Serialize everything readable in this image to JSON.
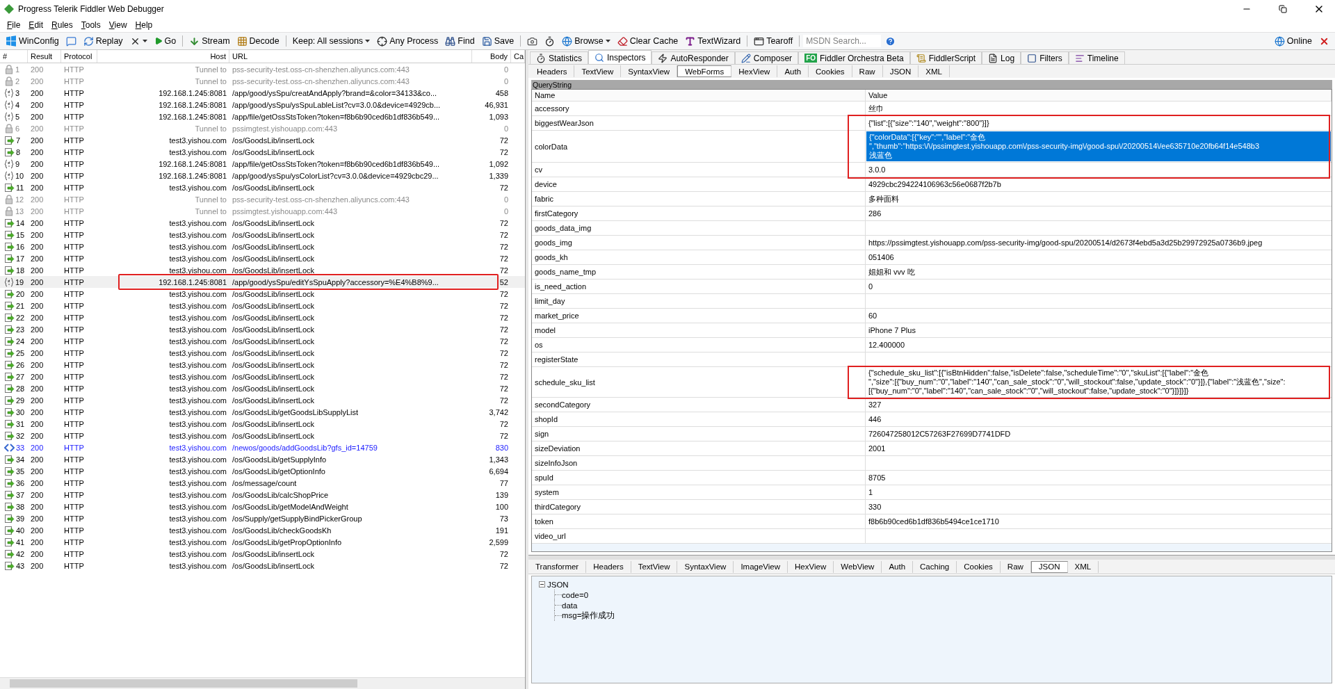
{
  "window": {
    "title": "Progress Telerik Fiddler Web Debugger"
  },
  "menu": [
    "File",
    "Edit",
    "Rules",
    "Tools",
    "View",
    "Help"
  ],
  "toolbar": [
    {
      "kind": "winconfig",
      "label": "WinConfig",
      "dropdown": false
    },
    {
      "kind": "comment",
      "dropdown": false
    },
    {
      "kind": "replay",
      "label": "Replay",
      "dropdown": false
    },
    {
      "kind": "remove",
      "dropdown": true
    },
    {
      "kind": "go",
      "label": "Go",
      "dropdown": false
    },
    {
      "kind": "separator"
    },
    {
      "kind": "stream",
      "label": "Stream",
      "dropdown": false
    },
    {
      "kind": "decode",
      "label": "Decode",
      "dropdown": false
    },
    {
      "kind": "separator"
    },
    {
      "kind": "keep",
      "label": "Keep: All sessions",
      "dropdown": true
    },
    {
      "kind": "process",
      "label": "Any Process",
      "dropdown": false
    },
    {
      "kind": "find",
      "label": "Find",
      "dropdown": false
    },
    {
      "kind": "save",
      "label": "Save",
      "dropdown": false
    },
    {
      "kind": "separator"
    },
    {
      "kind": "camera",
      "dropdown": false
    },
    {
      "kind": "timer",
      "dropdown": false
    },
    {
      "kind": "browse",
      "label": "Browse",
      "dropdown": true
    },
    {
      "kind": "clearcache",
      "label": "Clear Cache",
      "dropdown": false
    },
    {
      "kind": "textwizard",
      "label": "TextWizard",
      "dropdown": false
    },
    {
      "kind": "separator"
    },
    {
      "kind": "tearoff",
      "label": "Tearoff",
      "dropdown": false
    },
    {
      "kind": "separator"
    },
    {
      "kind": "search",
      "placeholder": "MSDN Search..."
    },
    {
      "kind": "help",
      "dropdown": false
    }
  ],
  "online": {
    "label": "Online"
  },
  "session_columns": [
    "#",
    "Result",
    "Protocol",
    "Host",
    "URL",
    "Body",
    "Ca"
  ],
  "sessions": [
    {
      "num": "1",
      "result": "200",
      "protocol": "HTTP",
      "host": "Tunnel to",
      "url": "pss-security-test.oss-cn-shenzhen.aliyuncs.com:443",
      "body": "0",
      "kind": "tunnel",
      "selected": false,
      "marked": false
    },
    {
      "num": "2",
      "result": "200",
      "protocol": "HTTP",
      "host": "Tunnel to",
      "url": "pss-security-test.oss-cn-shenzhen.aliyuncs.com:443",
      "body": "0",
      "kind": "tunnel",
      "selected": false,
      "marked": false
    },
    {
      "num": "3",
      "result": "200",
      "protocol": "HTTP",
      "host": "192.168.1.245:8081",
      "url": "/app/good/ysSpu/creatAndApply?brand=&color=34133&co...",
      "body": "458",
      "kind": "json",
      "selected": false,
      "marked": false
    },
    {
      "num": "4",
      "result": "200",
      "protocol": "HTTP",
      "host": "192.168.1.245:8081",
      "url": "/app/good/ysSpu/ysSpuLableList?cv=3.0.0&device=4929cb...",
      "body": "46,931",
      "kind": "json",
      "selected": false,
      "marked": false
    },
    {
      "num": "5",
      "result": "200",
      "protocol": "HTTP",
      "host": "192.168.1.245:8081",
      "url": "/app/file/getOssStsToken?token=f8b6b90ced6b1df836b549...",
      "body": "1,093",
      "kind": "json",
      "selected": false,
      "marked": false
    },
    {
      "num": "6",
      "result": "200",
      "protocol": "HTTP",
      "host": "Tunnel to",
      "url": "pssimgtest.yishouapp.com:443",
      "body": "0",
      "kind": "tunnel",
      "selected": false,
      "marked": false
    },
    {
      "num": "7",
      "result": "200",
      "protocol": "HTTP",
      "host": "test3.yishou.com",
      "url": "/os/GoodsLib/insertLock",
      "body": "72",
      "kind": "response",
      "selected": false,
      "marked": false
    },
    {
      "num": "8",
      "result": "200",
      "protocol": "HTTP",
      "host": "test3.yishou.com",
      "url": "/os/GoodsLib/insertLock",
      "body": "72",
      "kind": "response",
      "selected": false,
      "marked": false
    },
    {
      "num": "9",
      "result": "200",
      "protocol": "HTTP",
      "host": "192.168.1.245:8081",
      "url": "/app/file/getOssStsToken?token=f8b6b90ced6b1df836b549...",
      "body": "1,092",
      "kind": "json",
      "selected": false,
      "marked": false
    },
    {
      "num": "10",
      "result": "200",
      "protocol": "HTTP",
      "host": "192.168.1.245:8081",
      "url": "/app/good/ysSpu/ysColorList?cv=3.0.0&device=4929cbc29...",
      "body": "1,339",
      "kind": "json",
      "selected": false,
      "marked": false
    },
    {
      "num": "11",
      "result": "200",
      "protocol": "HTTP",
      "host": "test3.yishou.com",
      "url": "/os/GoodsLib/insertLock",
      "body": "72",
      "kind": "response",
      "selected": false,
      "marked": false
    },
    {
      "num": "12",
      "result": "200",
      "protocol": "HTTP",
      "host": "Tunnel to",
      "url": "pss-security-test.oss-cn-shenzhen.aliyuncs.com:443",
      "body": "0",
      "kind": "tunnel",
      "selected": false,
      "marked": false
    },
    {
      "num": "13",
      "result": "200",
      "protocol": "HTTP",
      "host": "Tunnel to",
      "url": "pssimgtest.yishouapp.com:443",
      "body": "0",
      "kind": "tunnel",
      "selected": false,
      "marked": false
    },
    {
      "num": "14",
      "result": "200",
      "protocol": "HTTP",
      "host": "test3.yishou.com",
      "url": "/os/GoodsLib/insertLock",
      "body": "72",
      "kind": "response",
      "selected": false,
      "marked": false
    },
    {
      "num": "15",
      "result": "200",
      "protocol": "HTTP",
      "host": "test3.yishou.com",
      "url": "/os/GoodsLib/insertLock",
      "body": "72",
      "kind": "response",
      "selected": false,
      "marked": false
    },
    {
      "num": "16",
      "result": "200",
      "protocol": "HTTP",
      "host": "test3.yishou.com",
      "url": "/os/GoodsLib/insertLock",
      "body": "72",
      "kind": "response",
      "selected": false,
      "marked": false
    },
    {
      "num": "17",
      "result": "200",
      "protocol": "HTTP",
      "host": "test3.yishou.com",
      "url": "/os/GoodsLib/insertLock",
      "body": "72",
      "kind": "response",
      "selected": false,
      "marked": false
    },
    {
      "num": "18",
      "result": "200",
      "protocol": "HTTP",
      "host": "test3.yishou.com",
      "url": "/os/GoodsLib/insertLock",
      "body": "72",
      "kind": "response",
      "selected": false,
      "marked": false
    },
    {
      "num": "19",
      "result": "200",
      "protocol": "HTTP",
      "host": "192.168.1.245:8081",
      "url": "/app/good/ysSpu/editYsSpuApply?accessory=%E4%B8%9...",
      "body": "52",
      "kind": "json",
      "selected": true,
      "marked": true
    },
    {
      "num": "20",
      "result": "200",
      "protocol": "HTTP",
      "host": "test3.yishou.com",
      "url": "/os/GoodsLib/insertLock",
      "body": "72",
      "kind": "response",
      "selected": false,
      "marked": false
    },
    {
      "num": "21",
      "result": "200",
      "protocol": "HTTP",
      "host": "test3.yishou.com",
      "url": "/os/GoodsLib/insertLock",
      "body": "72",
      "kind": "response",
      "selected": false,
      "marked": false
    },
    {
      "num": "22",
      "result": "200",
      "protocol": "HTTP",
      "host": "test3.yishou.com",
      "url": "/os/GoodsLib/insertLock",
      "body": "72",
      "kind": "response",
      "selected": false,
      "marked": false
    },
    {
      "num": "23",
      "result": "200",
      "protocol": "HTTP",
      "host": "test3.yishou.com",
      "url": "/os/GoodsLib/insertLock",
      "body": "72",
      "kind": "response",
      "selected": false,
      "marked": false
    },
    {
      "num": "24",
      "result": "200",
      "protocol": "HTTP",
      "host": "test3.yishou.com",
      "url": "/os/GoodsLib/insertLock",
      "body": "72",
      "kind": "response",
      "selected": false,
      "marked": false
    },
    {
      "num": "25",
      "result": "200",
      "protocol": "HTTP",
      "host": "test3.yishou.com",
      "url": "/os/GoodsLib/insertLock",
      "body": "72",
      "kind": "response",
      "selected": false,
      "marked": false
    },
    {
      "num": "26",
      "result": "200",
      "protocol": "HTTP",
      "host": "test3.yishou.com",
      "url": "/os/GoodsLib/insertLock",
      "body": "72",
      "kind": "response",
      "selected": false,
      "marked": false
    },
    {
      "num": "27",
      "result": "200",
      "protocol": "HTTP",
      "host": "test3.yishou.com",
      "url": "/os/GoodsLib/insertLock",
      "body": "72",
      "kind": "response",
      "selected": false,
      "marked": false
    },
    {
      "num": "28",
      "result": "200",
      "protocol": "HTTP",
      "host": "test3.yishou.com",
      "url": "/os/GoodsLib/insertLock",
      "body": "72",
      "kind": "response",
      "selected": false,
      "marked": false
    },
    {
      "num": "29",
      "result": "200",
      "protocol": "HTTP",
      "host": "test3.yishou.com",
      "url": "/os/GoodsLib/insertLock",
      "body": "72",
      "kind": "response",
      "selected": false,
      "marked": false
    },
    {
      "num": "30",
      "result": "200",
      "protocol": "HTTP",
      "host": "test3.yishou.com",
      "url": "/os/GoodsLib/getGoodsLibSupplyList",
      "body": "3,742",
      "kind": "response",
      "selected": false,
      "marked": false
    },
    {
      "num": "31",
      "result": "200",
      "protocol": "HTTP",
      "host": "test3.yishou.com",
      "url": "/os/GoodsLib/insertLock",
      "body": "72",
      "kind": "response",
      "selected": false,
      "marked": false
    },
    {
      "num": "32",
      "result": "200",
      "protocol": "HTTP",
      "host": "test3.yishou.com",
      "url": "/os/GoodsLib/insertLock",
      "body": "72",
      "kind": "response",
      "selected": false,
      "marked": false
    },
    {
      "num": "33",
      "result": "200",
      "protocol": "HTTP",
      "host": "test3.yishou.com",
      "url": "/newos/goods/addGoodsLib?gfs_id=14759",
      "body": "830",
      "kind": "html",
      "selected": false,
      "marked": false
    },
    {
      "num": "34",
      "result": "200",
      "protocol": "HTTP",
      "host": "test3.yishou.com",
      "url": "/os/GoodsLib/getSupplyInfo",
      "body": "1,343",
      "kind": "response",
      "selected": false,
      "marked": false
    },
    {
      "num": "35",
      "result": "200",
      "protocol": "HTTP",
      "host": "test3.yishou.com",
      "url": "/os/GoodsLib/getOptionInfo",
      "body": "6,694",
      "kind": "response",
      "selected": false,
      "marked": false
    },
    {
      "num": "36",
      "result": "200",
      "protocol": "HTTP",
      "host": "test3.yishou.com",
      "url": "/os/message/count",
      "body": "77",
      "kind": "response",
      "selected": false,
      "marked": false
    },
    {
      "num": "37",
      "result": "200",
      "protocol": "HTTP",
      "host": "test3.yishou.com",
      "url": "/os/GoodsLib/calcShopPrice",
      "body": "139",
      "kind": "response",
      "selected": false,
      "marked": false
    },
    {
      "num": "38",
      "result": "200",
      "protocol": "HTTP",
      "host": "test3.yishou.com",
      "url": "/os/GoodsLib/getModelAndWeight",
      "body": "100",
      "kind": "response",
      "selected": false,
      "marked": false
    },
    {
      "num": "39",
      "result": "200",
      "protocol": "HTTP",
      "host": "test3.yishou.com",
      "url": "/os/Supply/getSupplyBindPickerGroup",
      "body": "73",
      "kind": "response",
      "selected": false,
      "marked": false
    },
    {
      "num": "40",
      "result": "200",
      "protocol": "HTTP",
      "host": "test3.yishou.com",
      "url": "/os/GoodsLib/checkGoodsKh",
      "body": "191",
      "kind": "response",
      "selected": false,
      "marked": false
    },
    {
      "num": "41",
      "result": "200",
      "protocol": "HTTP",
      "host": "test3.yishou.com",
      "url": "/os/GoodsLib/getPropOptionInfo",
      "body": "2,599",
      "kind": "response",
      "selected": false,
      "marked": false
    },
    {
      "num": "42",
      "result": "200",
      "protocol": "HTTP",
      "host": "test3.yishou.com",
      "url": "/os/GoodsLib/insertLock",
      "body": "72",
      "kind": "response",
      "selected": false,
      "marked": false
    },
    {
      "num": "43",
      "result": "200",
      "protocol": "HTTP",
      "host": "test3.yishou.com",
      "url": "/os/GoodsLib/insertLock",
      "body": "72",
      "kind": "response",
      "selected": false,
      "marked": false
    }
  ],
  "inspector_tabs": [
    {
      "kind": "statistics",
      "label": "Statistics",
      "selected": false
    },
    {
      "kind": "inspectors",
      "label": "Inspectors",
      "selected": true
    },
    {
      "kind": "autoresponder",
      "label": "AutoResponder",
      "selected": false
    },
    {
      "kind": "composer",
      "label": "Composer",
      "selected": false
    },
    {
      "kind": "orchestra",
      "badge": "FO",
      "label": "Fiddler Orchestra Beta",
      "selected": false
    },
    {
      "kind": "script",
      "label": "FiddlerScript",
      "selected": false
    },
    {
      "kind": "log",
      "label": "Log",
      "selected": false
    },
    {
      "kind": "filters",
      "label": "Filters",
      "selected": false
    },
    {
      "kind": "timeline",
      "label": "Timeline",
      "selected": false
    }
  ],
  "request_tabs": [
    {
      "label": "Headers",
      "selected": false
    },
    {
      "label": "TextView",
      "selected": false
    },
    {
      "label": "SyntaxView",
      "selected": false
    },
    {
      "label": "WebForms",
      "selected": true
    },
    {
      "label": "HexView",
      "selected": false
    },
    {
      "label": "Auth",
      "selected": false
    },
    {
      "label": "Cookies",
      "selected": false
    },
    {
      "label": "Raw",
      "selected": false
    },
    {
      "label": "JSON",
      "selected": false
    },
    {
      "label": "XML",
      "selected": false
    }
  ],
  "querystring": {
    "title": "QueryString",
    "columns": [
      "Name",
      "Value"
    ],
    "params": [
      {
        "name": "accessory",
        "value": "丝巾",
        "selected": false,
        "marked": false
      },
      {
        "name": "biggestWearJson",
        "value": "{\"list\":[{\"size\":\"140\",\"weight\":\"800\"}]}",
        "selected": false,
        "marked": true
      },
      {
        "name": "colorData",
        "value": "{\"colorData\":[{\"key\":\"\",\"label\":\"金色\n\",\"thumb\":\"https:\\/\\/pssimgtest.yishouapp.com\\/pss-security-img\\/good-spu\\/20200514\\/ee635710e20fb64f14e548b3\n浅蓝色",
        "selected": true,
        "marked": true
      },
      {
        "name": "cv",
        "value": "3.0.0",
        "selected": false,
        "marked": true
      },
      {
        "name": "device",
        "value": "4929cbc294224106963c56e0687f2b7b",
        "selected": false,
        "marked": false
      },
      {
        "name": "fabric",
        "value": "多种面料",
        "selected": false,
        "marked": false
      },
      {
        "name": "firstCategory",
        "value": "286",
        "selected": false,
        "marked": false
      },
      {
        "name": "goods_data_img",
        "selected": false,
        "marked": false
      },
      {
        "name": "goods_img",
        "value": "https://pssimgtest.yishouapp.com/pss-security-img/good-spu/20200514/d2673f4ebd5a3d25b29972925a0736b9.jpeg",
        "selected": false,
        "marked": false
      },
      {
        "name": "goods_kh",
        "value": "051406",
        "selected": false,
        "marked": false
      },
      {
        "name": "goods_name_tmp",
        "value": "姐姐和 vvv 吃",
        "selected": false,
        "marked": false
      },
      {
        "name": "is_need_action",
        "value": "0",
        "selected": false,
        "marked": false
      },
      {
        "name": "limit_day",
        "selected": false,
        "marked": false
      },
      {
        "name": "market_price",
        "value": "60",
        "selected": false,
        "marked": false
      },
      {
        "name": "model",
        "value": "iPhone 7 Plus",
        "selected": false,
        "marked": false
      },
      {
        "name": "os",
        "value": "12.400000",
        "selected": false,
        "marked": false
      },
      {
        "name": "registerState",
        "selected": false,
        "marked": false
      },
      {
        "name": "schedule_sku_list",
        "value": "{\"schedule_sku_list\":[{\"isBtnHidden\":false,\"isDelete\":false,\"scheduleTime\":\"0\",\"skuList\":[{\"label\":\"金色\n\",\"size\":[{\"buy_num\":\"0\",\"label\":\"140\",\"can_sale_stock\":\"0\",\"will_stockout\":false,\"update_stock\":\"0\"}]},{\"label\":\"浅蓝色\",\"size\":[{\"buy_num\":\"0\",\"label\":\"140\",\"can_sale_stock\":\"0\",\"will_stockout\":false,\"update_stock\":\"0\"}]}]}]}",
        "selected": false,
        "marked": true
      },
      {
        "name": "secondCategory",
        "value": "327",
        "selected": false,
        "marked": false
      },
      {
        "name": "shopId",
        "value": "446",
        "selected": false,
        "marked": false
      },
      {
        "name": "sign",
        "value": "726047258012C57263F27699D7741DFD",
        "selected": false,
        "marked": false
      },
      {
        "name": "sizeDeviation",
        "value": "2001",
        "selected": false,
        "marked": false
      },
      {
        "name": "sizeInfoJson",
        "selected": false,
        "marked": false
      },
      {
        "name": "spuId",
        "value": "8705",
        "selected": false,
        "marked": false
      },
      {
        "name": "system",
        "value": "1",
        "selected": false,
        "marked": false
      },
      {
        "name": "thirdCategory",
        "value": "330",
        "selected": false,
        "marked": false
      },
      {
        "name": "token",
        "value": "f8b6b90ced6b1df836b5494ce1ce1710",
        "selected": false,
        "marked": false
      },
      {
        "name": "video_url",
        "selected": false,
        "marked": false
      }
    ]
  },
  "response_tabs": [
    {
      "label": "Transformer",
      "selected": false
    },
    {
      "label": "Headers",
      "selected": false
    },
    {
      "label": "TextView",
      "selected": false
    },
    {
      "label": "SyntaxView",
      "selected": false
    },
    {
      "label": "ImageView",
      "selected": false
    },
    {
      "label": "HexView",
      "selected": false
    },
    {
      "label": "WebView",
      "selected": false
    },
    {
      "label": "Auth",
      "selected": false
    },
    {
      "label": "Caching",
      "selected": false
    },
    {
      "label": "Cookies",
      "selected": false
    },
    {
      "label": "Raw",
      "selected": false
    },
    {
      "label": "JSON",
      "selected": true
    },
    {
      "label": "XML",
      "selected": false
    }
  ],
  "tree": {
    "label": "JSON",
    "expanded": true,
    "children": [
      {
        "label": "code=0"
      },
      {
        "label": "data"
      },
      {
        "label": "msg=操作成功"
      }
    ]
  }
}
